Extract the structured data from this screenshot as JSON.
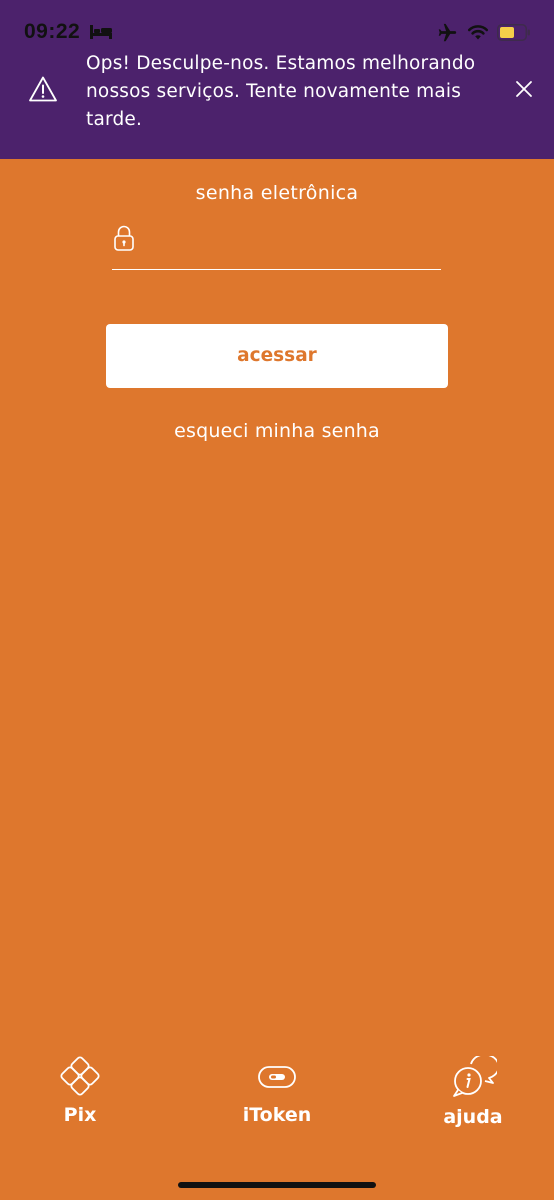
{
  "status_bar": {
    "time": "09:22",
    "icons": [
      "bed-icon",
      "airplane-icon",
      "wifi-icon",
      "battery-icon"
    ]
  },
  "banner": {
    "icon": "warning-icon",
    "message": "Ops! Desculpe-nos. Estamos melhorando nossos serviços. Tente novamente mais tarde.",
    "close_icon": "close-icon",
    "background": "#4C226C"
  },
  "login": {
    "password_label": "senha eletrônica",
    "password_value": "",
    "lock_icon": "lock-icon",
    "access_button": "acessar",
    "forgot_password": "esqueci minha senha"
  },
  "bottom_nav": {
    "items": [
      {
        "label": "Pix",
        "icon": "pix-icon"
      },
      {
        "label": "iToken",
        "icon": "itoken-icon"
      },
      {
        "label": "ajuda",
        "icon": "help-chat-icon"
      }
    ]
  },
  "colors": {
    "background": "#DE772D",
    "banner": "#4C226C",
    "button_text": "#DE772D",
    "text": "#FFFFFF"
  }
}
